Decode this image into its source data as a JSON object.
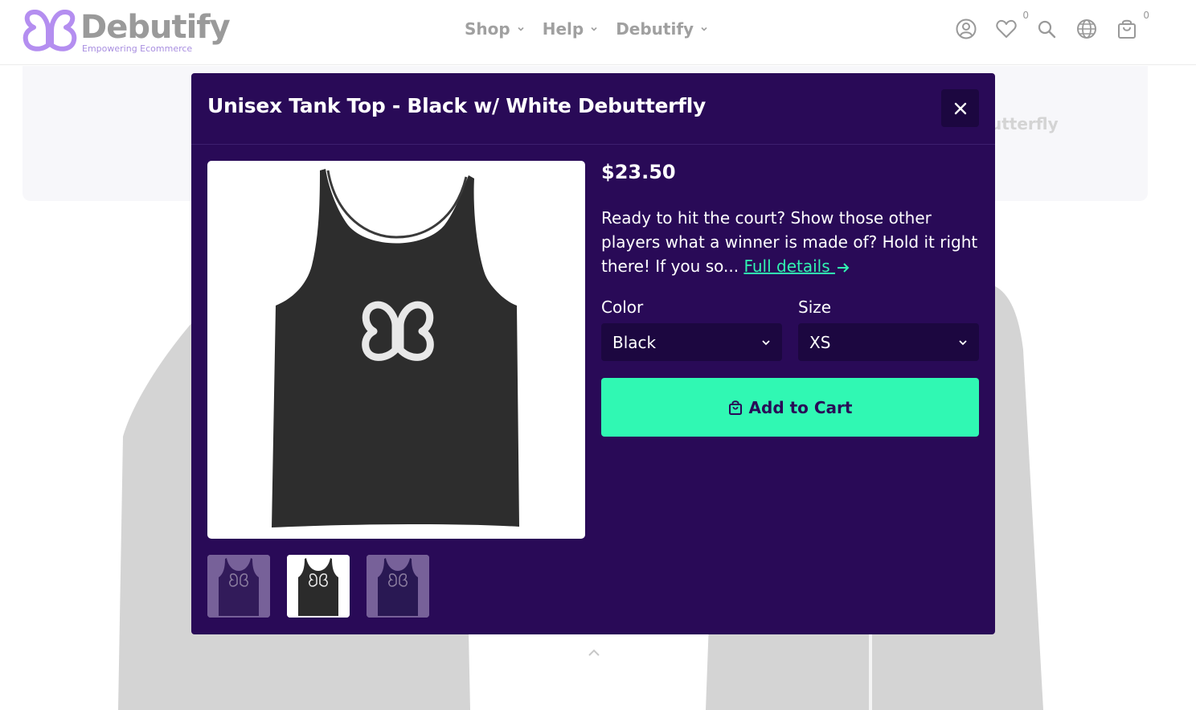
{
  "header": {
    "logo_name": "Debutify",
    "logo_tagline": "Empowering Ecommerce",
    "nav": [
      {
        "label": "Shop"
      },
      {
        "label": "Help"
      },
      {
        "label": "Debutify"
      }
    ],
    "wishlist_count": "0",
    "cart_count": "0"
  },
  "background": {
    "banner_text": "utterfly"
  },
  "modal": {
    "title": "Unisex Tank Top - Black w/ White Debutterfly",
    "price": "$23.50",
    "description": "Ready to hit the court? Show those other players what a winner is made of? Hold it right there! If you so...",
    "full_details_label": "Full details",
    "color_label": "Color",
    "color_value": "Black",
    "size_label": "Size",
    "size_value": "XS",
    "add_to_cart_label": "Add to Cart"
  },
  "colors": {
    "modal_bg": "#290a57",
    "accent": "#30f8b3",
    "select_bg": "#1c0740"
  }
}
